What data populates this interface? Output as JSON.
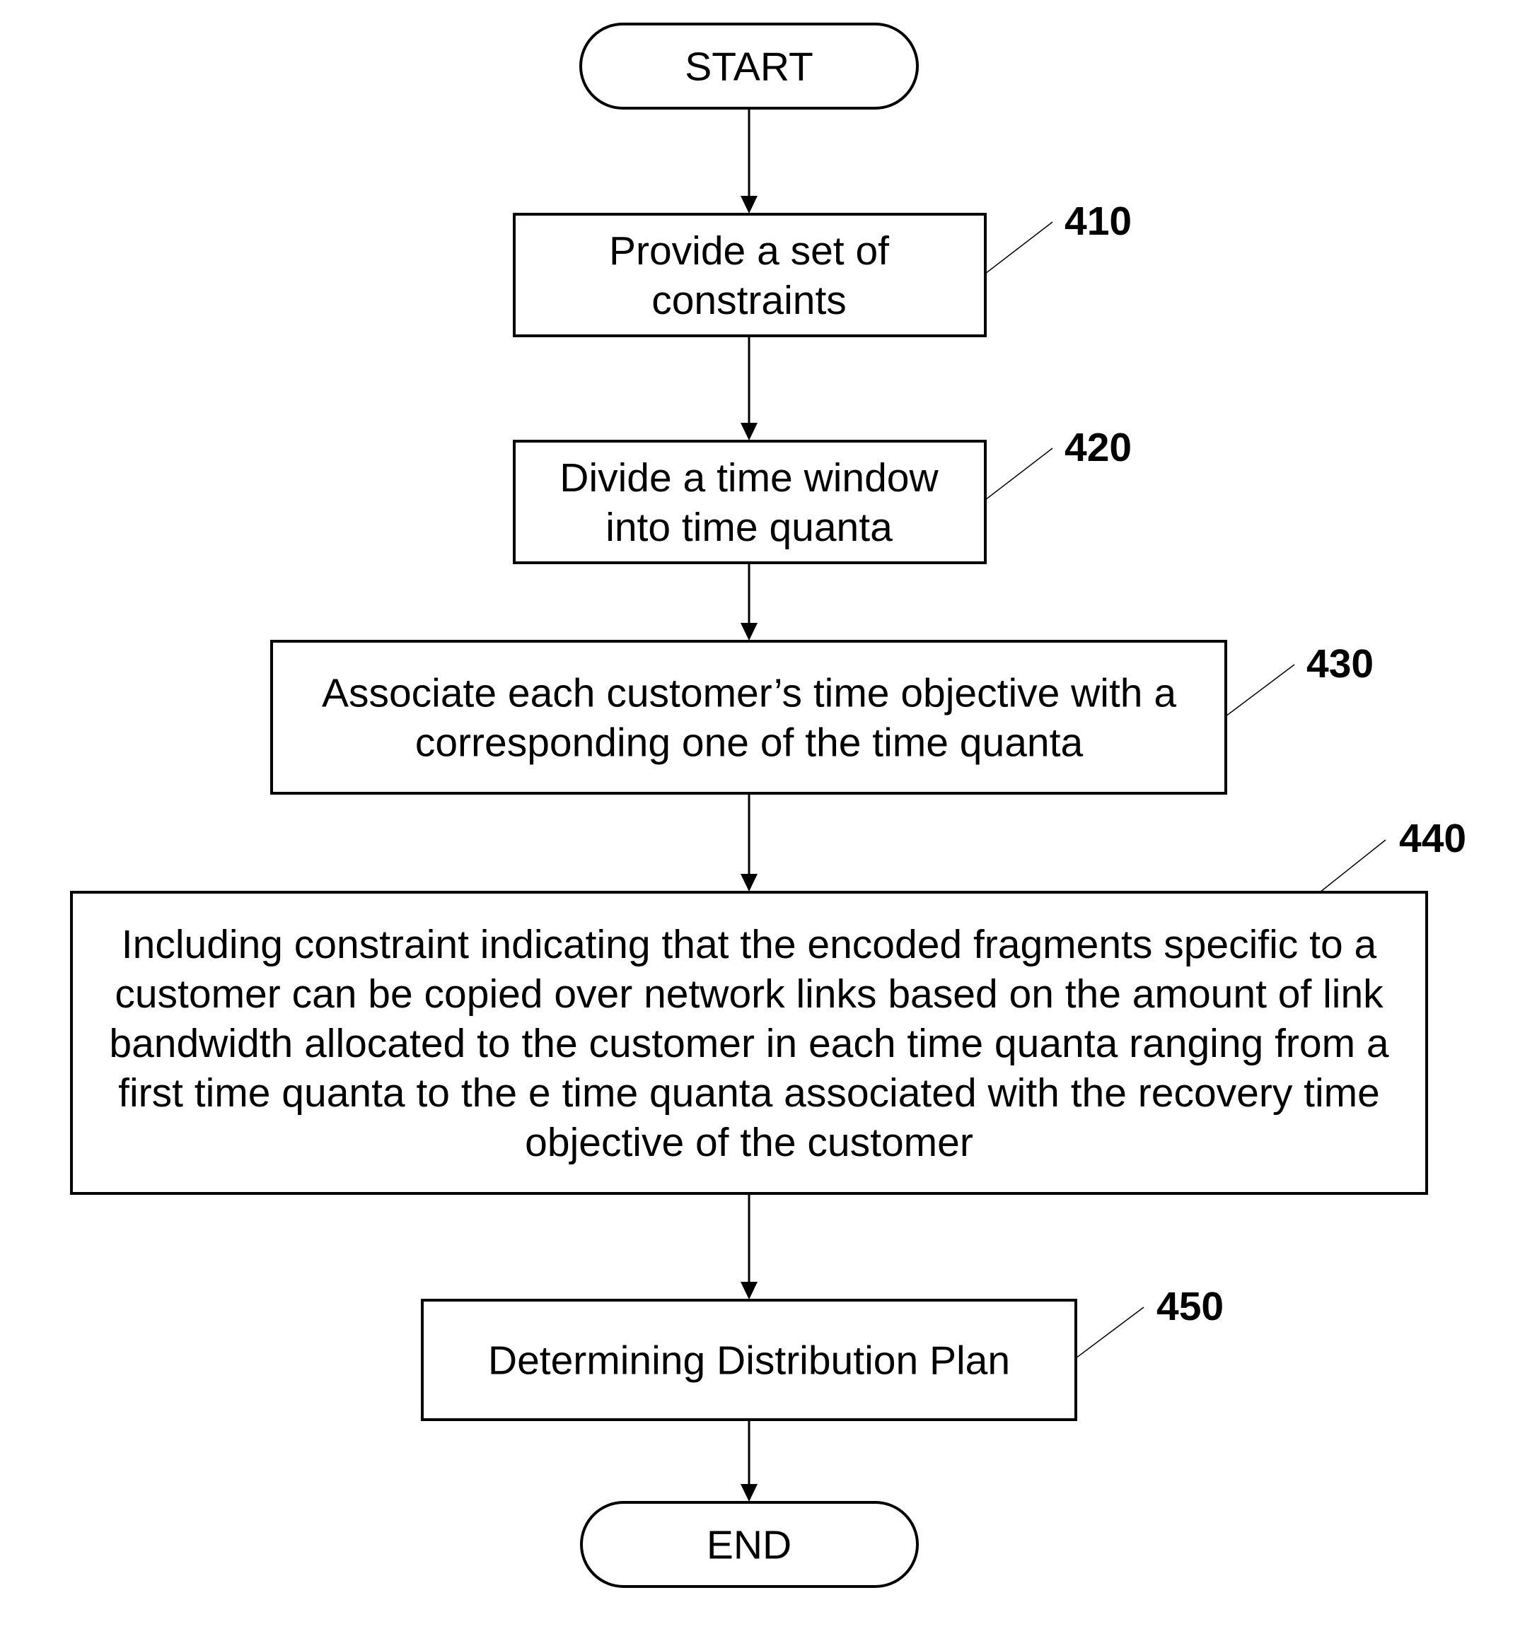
{
  "diagram": {
    "type": "flowchart",
    "nodes": [
      {
        "id": "start",
        "kind": "terminator",
        "lines": [
          "START"
        ]
      },
      {
        "id": "410",
        "kind": "process",
        "ref": "410",
        "lines": [
          "Provide a set of",
          "constraints"
        ]
      },
      {
        "id": "420",
        "kind": "process",
        "ref": "420",
        "lines": [
          "Divide a time window",
          "into time quanta"
        ]
      },
      {
        "id": "430",
        "kind": "process",
        "ref": "430",
        "lines": [
          "Associate each customer’s time objective  with a",
          "corresponding one of the time quanta"
        ]
      },
      {
        "id": "440",
        "kind": "process",
        "ref": "440",
        "lines": [
          "Including constraint indicating that the encoded fragments specific to a",
          "customer can be copied over network links based on the amount of link",
          "bandwidth allocated to the customer in each time quanta ranging from a",
          "first time quanta to the e time quanta associated with the recovery time",
          "objective of the customer"
        ]
      },
      {
        "id": "450",
        "kind": "process",
        "ref": "450",
        "lines": [
          "Determining Distribution Plan"
        ]
      },
      {
        "id": "end",
        "kind": "terminator",
        "lines": [
          "END"
        ]
      }
    ],
    "edges": [
      {
        "from": "start",
        "to": "410"
      },
      {
        "from": "410",
        "to": "420"
      },
      {
        "from": "420",
        "to": "430"
      },
      {
        "from": "430",
        "to": "440"
      },
      {
        "from": "440",
        "to": "450"
      },
      {
        "from": "450",
        "to": "end"
      }
    ]
  }
}
